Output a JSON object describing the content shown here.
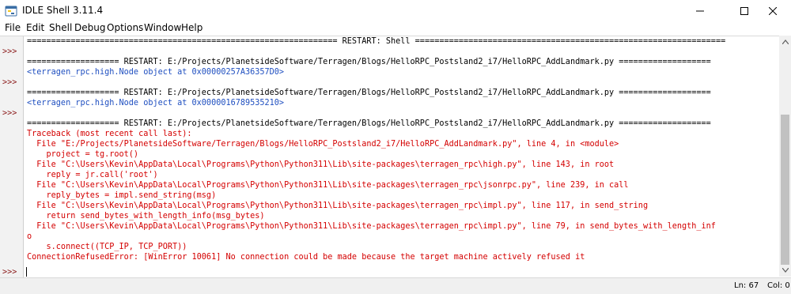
{
  "window": {
    "title": "IDLE Shell 3.11.4"
  },
  "menu": [
    "File",
    "Edit",
    "Shell",
    "Debug",
    "Options",
    "Window",
    "Help"
  ],
  "prompts": [
    ">>>",
    ">>>",
    ">>>",
    ">>>"
  ],
  "lines": [
    {
      "text": "================================================================ RESTART: Shell ================================================================",
      "style": "restart"
    },
    {
      "text": "",
      "style": "restart"
    },
    {
      "text": "=================== RESTART: E:/Projects/PlanetsideSoftware/Terragen/Blogs/HelloRPC_Postsland2_i7/HelloRPC_AddLandmark.py ===================",
      "style": "restart"
    },
    {
      "text": "<terragen_rpc.high.Node object at 0x00000257A36357D0>",
      "style": "blue"
    },
    {
      "text": "",
      "style": "restart"
    },
    {
      "text": "=================== RESTART: E:/Projects/PlanetsideSoftware/Terragen/Blogs/HelloRPC_Postsland2_i7/HelloRPC_AddLandmark.py ===================",
      "style": "restart"
    },
    {
      "text": "<terragen_rpc.high.Node object at 0x0000016789535210>",
      "style": "blue"
    },
    {
      "text": "",
      "style": "restart"
    },
    {
      "text": "=================== RESTART: E:/Projects/PlanetsideSoftware/Terragen/Blogs/HelloRPC_Postsland2_i7/HelloRPC_AddLandmark.py ===================",
      "style": "restart"
    },
    {
      "text": "Traceback (most recent call last):",
      "style": "red"
    },
    {
      "text": "  File \"E:/Projects/PlanetsideSoftware/Terragen/Blogs/HelloRPC_Postsland2_i7/HelloRPC_AddLandmark.py\", line 4, in <module>",
      "style": "red"
    },
    {
      "text": "    project = tg.root()",
      "style": "red"
    },
    {
      "text": "  File \"C:\\Users\\Kevin\\AppData\\Local\\Programs\\Python\\Python311\\Lib\\site-packages\\terragen_rpc\\high.py\", line 143, in root",
      "style": "red"
    },
    {
      "text": "    reply = jr.call('root')",
      "style": "red"
    },
    {
      "text": "  File \"C:\\Users\\Kevin\\AppData\\Local\\Programs\\Python\\Python311\\Lib\\site-packages\\terragen_rpc\\jsonrpc.py\", line 239, in call",
      "style": "red"
    },
    {
      "text": "    reply_bytes = impl.send_string(msg)",
      "style": "red"
    },
    {
      "text": "  File \"C:\\Users\\Kevin\\AppData\\Local\\Programs\\Python\\Python311\\Lib\\site-packages\\terragen_rpc\\impl.py\", line 117, in send_string",
      "style": "red"
    },
    {
      "text": "    return send_bytes_with_length_info(msg_bytes)",
      "style": "red"
    },
    {
      "text": "  File \"C:\\Users\\Kevin\\AppData\\Local\\Programs\\Python\\Python311\\Lib\\site-packages\\terragen_rpc\\impl.py\", line 79, in send_bytes_with_length_inf",
      "style": "red"
    },
    {
      "text": "o",
      "style": "red"
    },
    {
      "text": "    s.connect((TCP_IP, TCP_PORT))",
      "style": "red"
    },
    {
      "text": "ConnectionRefusedError: [WinError 10061] No connection could be made because the target machine actively refused it",
      "style": "red"
    }
  ],
  "status": {
    "ln": "Ln: 67",
    "col": "Col: 0"
  }
}
